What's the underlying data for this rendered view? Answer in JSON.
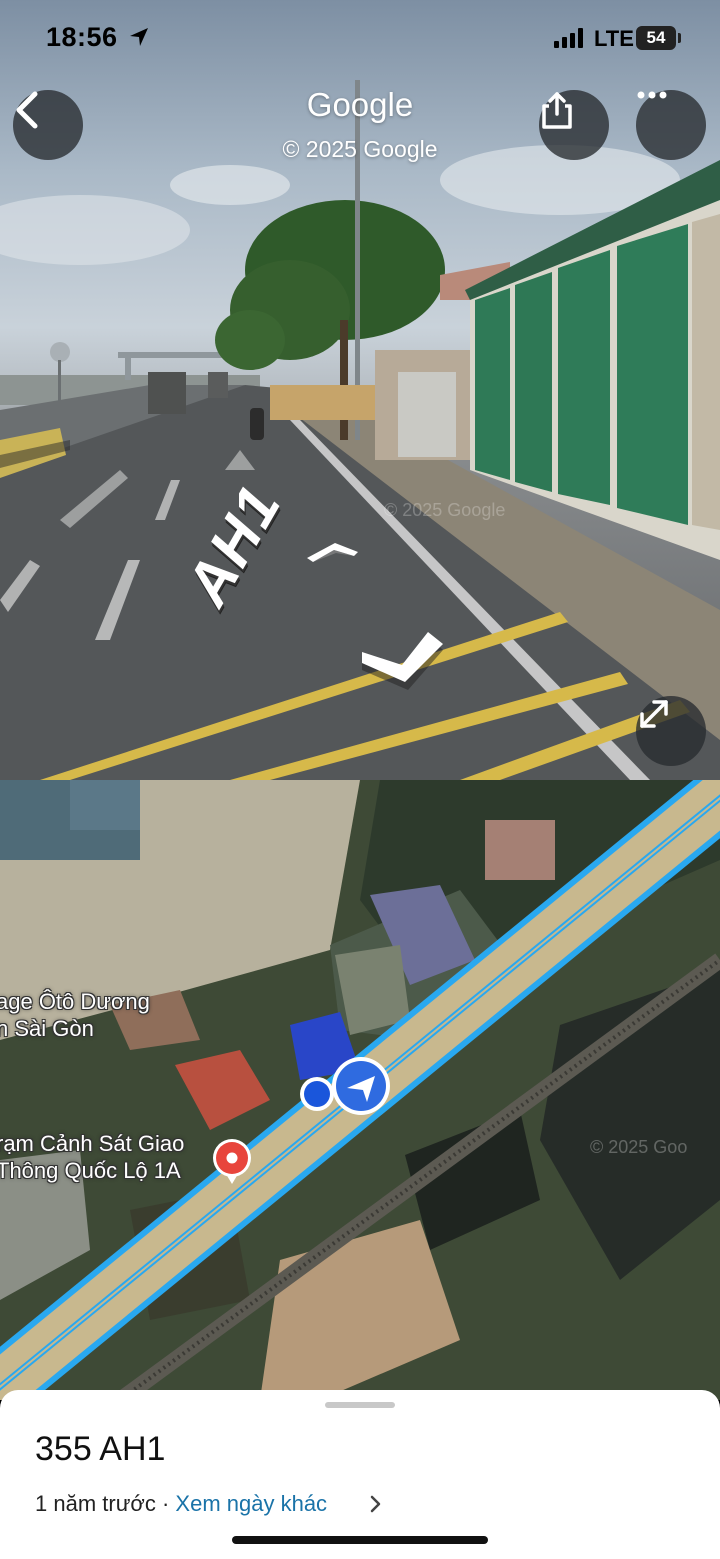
{
  "status_bar": {
    "time": "18:56",
    "network": "LTE",
    "battery": "54"
  },
  "street_view": {
    "brand": "Google",
    "copyright": "© 2025 Google",
    "road_label": "AH1",
    "watermark": "© 2025 Google",
    "buttons": {
      "back_icon": "chevron-left-icon",
      "share_icon": "share-icon",
      "more_icon": "more-horizontal-icon",
      "expand_icon": "expand-icon"
    }
  },
  "map": {
    "places": [
      {
        "line1": "age Ôtô Dương",
        "line2": "n Sài Gòn"
      },
      {
        "line1": "rạm Cảnh Sát Giao",
        "line2": "Thông Quốc Lộ 1A"
      }
    ],
    "watermark": "© 2025 Goo",
    "colors": {
      "route": "#29a8f0",
      "pin": "#e8453c",
      "location": "#1a56db"
    }
  },
  "sheet": {
    "address": "355 AH1",
    "date_text": "1 năm trước",
    "separator": " · ",
    "other_dates_link": "Xem ngày khác"
  }
}
